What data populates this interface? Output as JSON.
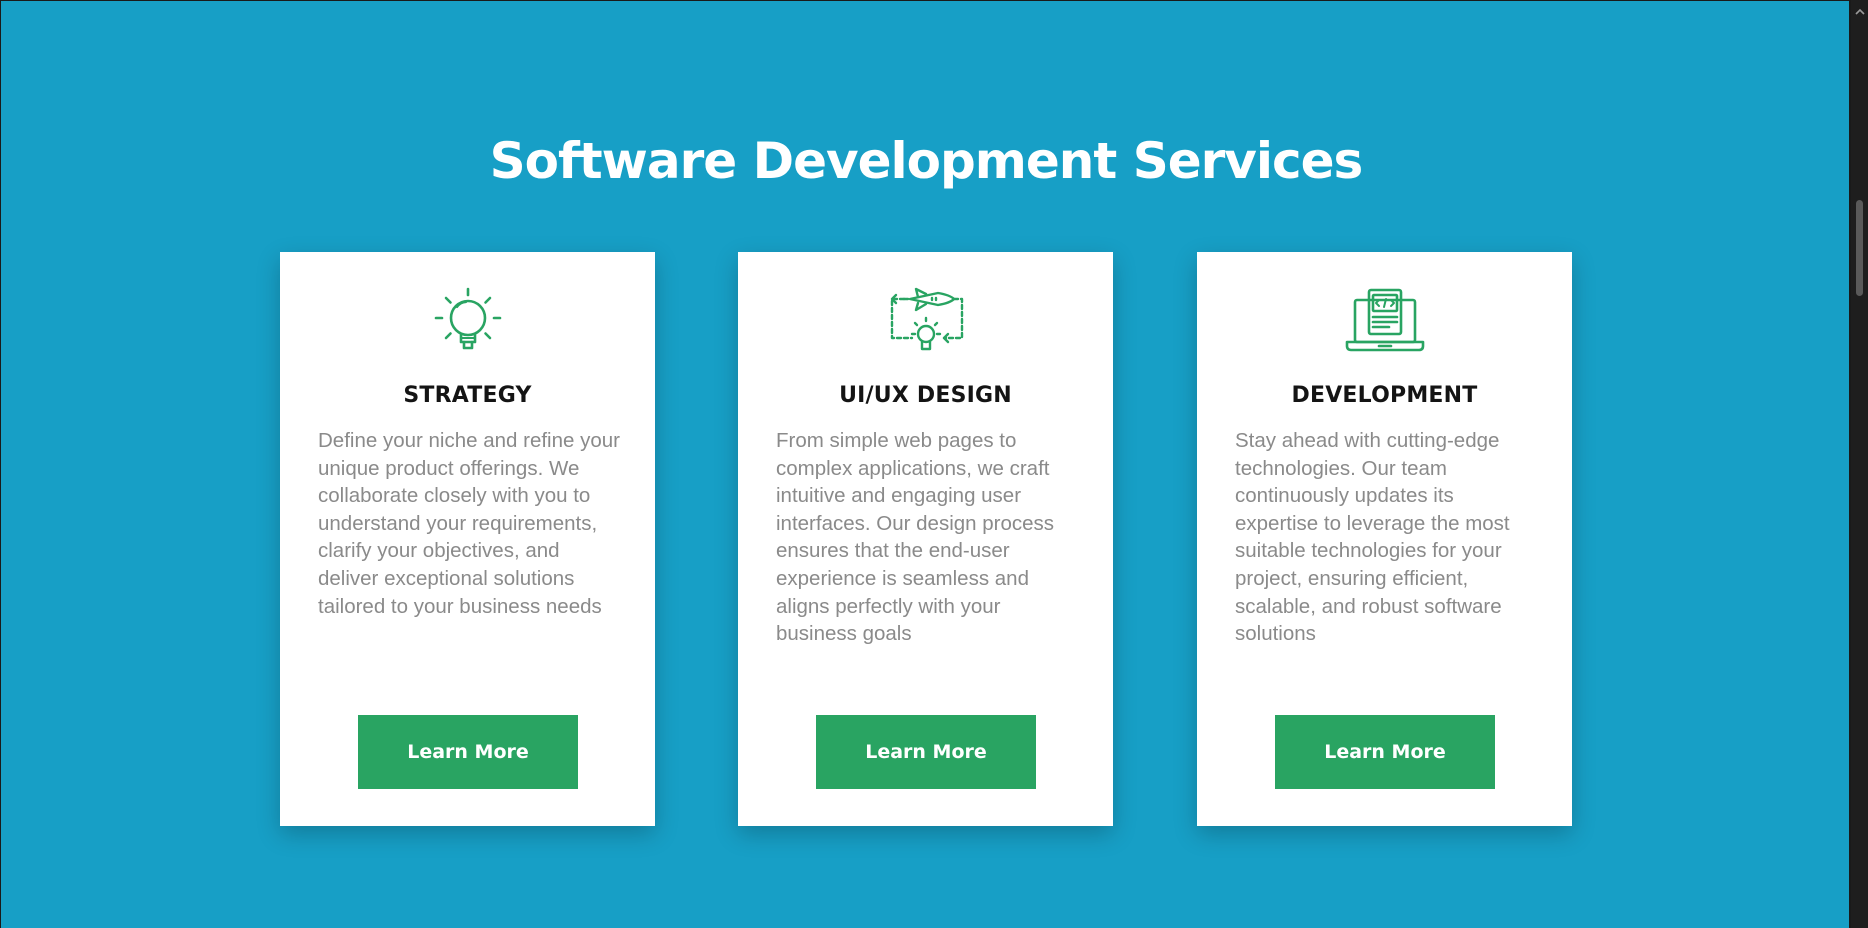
{
  "section": {
    "title": "Software Development Services"
  },
  "colors": {
    "background": "#179fc6",
    "accent_green": "#29a462",
    "card": "#ffffff",
    "title_text": "#141414",
    "body_text": "#8a8a8a"
  },
  "cards": [
    {
      "icon": "lightbulb-icon",
      "title": "STRATEGY",
      "description": "Define your niche and refine your unique product offerings. We collaborate closely with you to understand your requirements, clarify your objectives, and deliver exceptional solutions tailored to your business needs",
      "button_label": "Learn More"
    },
    {
      "icon": "rocket-cycle-icon",
      "title": "UI/UX DESIGN",
      "description": "From simple web pages to complex applications, we craft intuitive and engaging user interfaces. Our design process ensures that the end-user experience is seamless and aligns perfectly with your business goals",
      "button_label": "Learn More"
    },
    {
      "icon": "laptop-code-icon",
      "title": "DEVELOPMENT",
      "description": "Stay ahead with cutting-edge technologies. Our team continuously updates its expertise to leverage the most suitable technologies for your project, ensuring efficient, scalable, and robust software solutions",
      "button_label": "Learn More"
    }
  ]
}
